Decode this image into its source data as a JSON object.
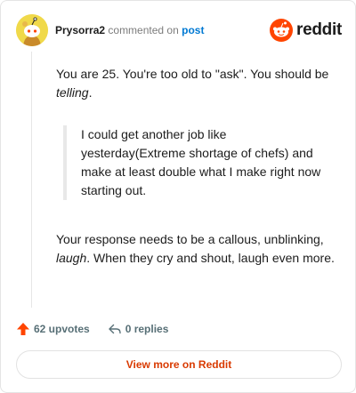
{
  "header": {
    "username": "Prysorra2",
    "commented_on": "commented on",
    "post_link": "post",
    "brand": "reddit"
  },
  "comment": {
    "p1_main": "You are 25. You're too old to \"ask\". You should be ",
    "p1_em": "telling",
    "p1_end": ".",
    "quote": "I could get another job like yesterday(Extreme shortage of chefs) and make at least double what I make right now starting out.",
    "p2_start": "Your response needs to be a callous, unblinking, ",
    "p2_em": "laugh",
    "p2_end": ". When they cry and shout, laugh even more."
  },
  "actions": {
    "upvotes": "62 upvotes",
    "replies": "0 replies"
  },
  "footer": {
    "view_more": "View more on Reddit"
  },
  "colors": {
    "brand_orange": "#ff4500",
    "link_blue": "#0079d3",
    "cta_text": "#d93a00"
  }
}
